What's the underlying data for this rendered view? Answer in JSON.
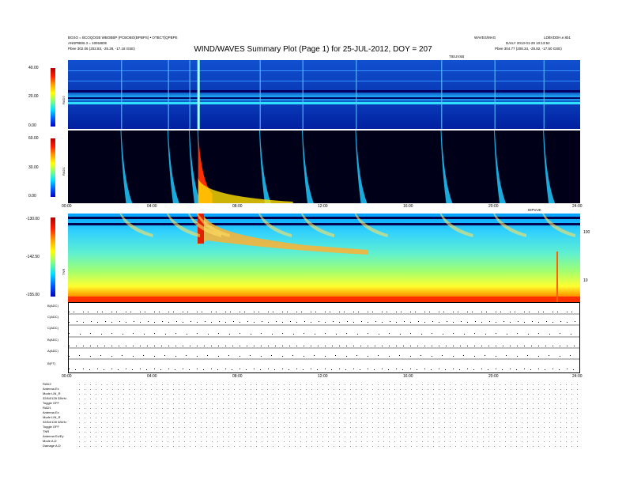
{
  "chart_data": [
    {
      "type": "heatmap",
      "title": "WIND/WAVES Summary Plot (Page 1) for 25-JUL-2012, DOY = 207",
      "header_left": [
        "BGSO = BCOQOGB WBOBBP (PCBOBO(BPBPS) • OTBCT(QPBPE",
        "ANSPBEB.3 = 1091BDE",
        "Pbee   302.06 (202.83, -25.28, -17.18 GSE)"
      ],
      "header_right": [
        "WAVES/MAG",
        "LDBVDDH.e.8b1",
        "DAILY 2013-01-29 10:13:52",
        "Pbee   304.77 (208.34, -28.82, -17.50 GSE)"
      ],
      "time_label": "TIEUVSB",
      "panel": "RAD2",
      "colorbar_ticks": [
        "40.00",
        "20.00",
        "0.00"
      ],
      "x_ticks": [
        "00:00",
        "04:00",
        "08:00",
        "12:00",
        "16:00",
        "20:00",
        "24:00"
      ],
      "events_hours": [
        2.5,
        4.7,
        5.7,
        6.1,
        9.0,
        11.0,
        13.5,
        17.5,
        20.0,
        22.3
      ]
    },
    {
      "type": "heatmap",
      "panel": "RAD1",
      "colorbar_ticks": [
        "60.00",
        "30.00",
        "0.00"
      ],
      "x_ticks": [
        "00:00",
        "04:00",
        "08:00",
        "12:00",
        "16:00",
        "20:00",
        "24:00"
      ],
      "x_right_label": "DIPVUK"
    },
    {
      "type": "heatmap",
      "panel": "TNR",
      "colorbar_ticks": [
        "-130.00",
        "-142.50",
        "-155.00"
      ],
      "right_ticks": [
        "100",
        "10"
      ]
    },
    {
      "type": "line",
      "panel": "TDS",
      "series": [
        {
          "name": "B(ADC)"
        },
        {
          "name": "C(ADC)"
        },
        {
          "name": "C(ADC)"
        },
        {
          "name": "B(ADC)"
        },
        {
          "name": "A(ADC)"
        },
        {
          "name": "B(FT)"
        }
      ],
      "x_ticks": [
        "00:00",
        "04:00",
        "08:00",
        "12:00",
        "16:00",
        "20:00",
        "24:00"
      ]
    }
  ],
  "params": {
    "rad2": {
      "heading": "RAD2",
      "lines": [
        "Antenna  Ex",
        "Mode  LIN_R",
        "32/64/128 32kHz",
        "Toggle  OFF"
      ]
    },
    "rad1": {
      "heading": "RAD1",
      "lines": [
        "Antenna  Ex",
        "Mode  LIN_R",
        "32/64/128 32kHz",
        "Toggle  OFF"
      ]
    },
    "tnr": {
      "heading": "TNR",
      "lines": [
        "Antenna  Ex/Ey",
        "Mode  A,D",
        "Damage  A,D"
      ]
    }
  },
  "colors": {
    "jet_low": "#00008b",
    "jet_high": "#cc0000",
    "burst": "#ff2000"
  }
}
